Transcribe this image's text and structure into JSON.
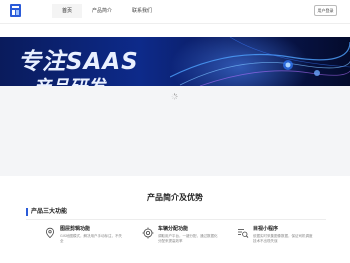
{
  "header": {
    "nav": [
      "首页",
      "产品简介",
      "联系我们"
    ],
    "active_nav_index": 0,
    "login_label": "用户登录"
  },
  "banner": {
    "title": "专注SAAS",
    "subtitle": "产品研发"
  },
  "intro": {
    "section_title": "产品简介及优势",
    "subhead": "产品三大功能",
    "features": [
      {
        "icon": "location-pin-icon",
        "name": "图层剪辑功能",
        "desc": "GIS地图模式，解决用户手动标注，不失全"
      },
      {
        "icon": "crosshair-icon",
        "name": "车辆分配功能",
        "desc": "调取用户平台，一键分配，通过数据化分配来提高效率"
      },
      {
        "icon": "list-search-icon",
        "name": "目视小程序",
        "desc": "依据实时采集图像数据，保证司机调度技术不出现失误"
      }
    ]
  },
  "colors": {
    "accent": "#2b5bd8",
    "banner_dark": "#0a1b5c",
    "loading_bg": "#f4f5f7"
  }
}
